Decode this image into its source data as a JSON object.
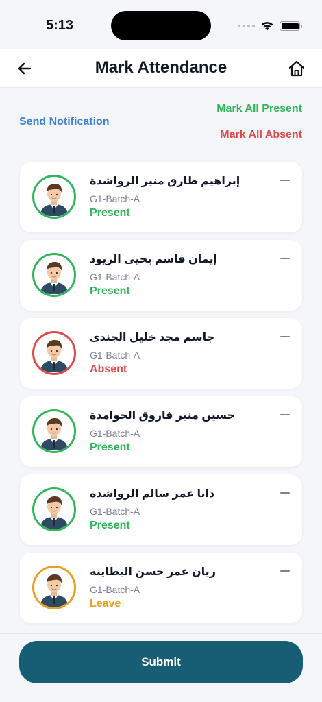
{
  "status_bar": {
    "time": "5:13",
    "icons": [
      "signal-icon",
      "wifi-icon",
      "battery-icon"
    ]
  },
  "header": {
    "title": "Mark Attendance",
    "back_icon": "arrow-left-icon",
    "home_icon": "home-icon"
  },
  "actions": {
    "send_notification": "Send Notification",
    "mark_all_present": "Mark All Present",
    "mark_all_absent": "Mark All Absent"
  },
  "colors": {
    "present": "#2fb65a",
    "absent": "#e04848",
    "leave": "#e8a020",
    "link": "#3d7fd6",
    "primary": "#175e74"
  },
  "students": [
    {
      "name": "إبراهيم طارق منير الرواشدة",
      "batch": "G1-Batch-A",
      "status": "Present",
      "status_key": "present"
    },
    {
      "name": "إيمان قاسم يحيى الزيود",
      "batch": "G1-Batch-A",
      "status": "Present",
      "status_key": "present"
    },
    {
      "name": "جاسم مجد خليل الجندي",
      "batch": "G1-Batch-A",
      "status": "Absent",
      "status_key": "absent"
    },
    {
      "name": "حسين منير فاروق الحوامدة",
      "batch": "G1-Batch-A",
      "status": "Present",
      "status_key": "present"
    },
    {
      "name": "دانا عمر سالم الرواشدة",
      "batch": "G1-Batch-A",
      "status": "Present",
      "status_key": "present"
    },
    {
      "name": "ريان عمر حسن البطاينة",
      "batch": "G1-Batch-A",
      "status": "Leave",
      "status_key": "leave"
    }
  ],
  "submit_label": "Submit"
}
